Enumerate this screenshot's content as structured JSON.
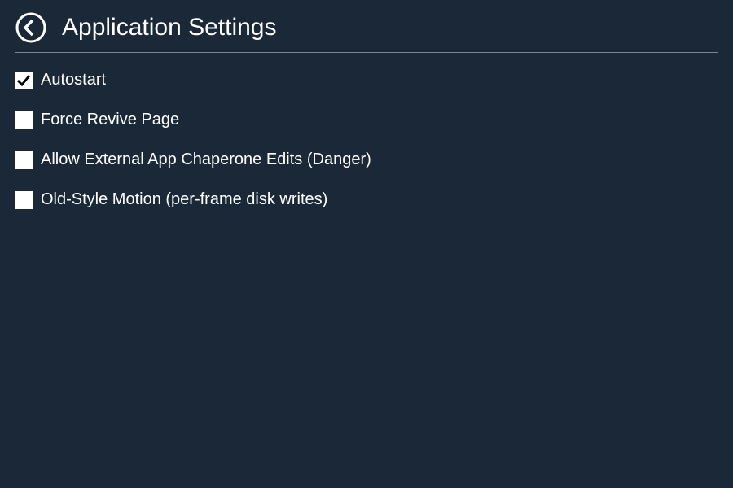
{
  "header": {
    "title": "Application Settings"
  },
  "settings": [
    {
      "key": "autostart",
      "label": "Autostart",
      "checked": true
    },
    {
      "key": "force-revive-page",
      "label": "Force Revive Page",
      "checked": false
    },
    {
      "key": "allow-external-chaperone",
      "label": "Allow External App Chaperone Edits (Danger)",
      "checked": false
    },
    {
      "key": "old-style-motion",
      "label": "Old-Style Motion (per-frame disk writes)",
      "checked": false
    }
  ]
}
